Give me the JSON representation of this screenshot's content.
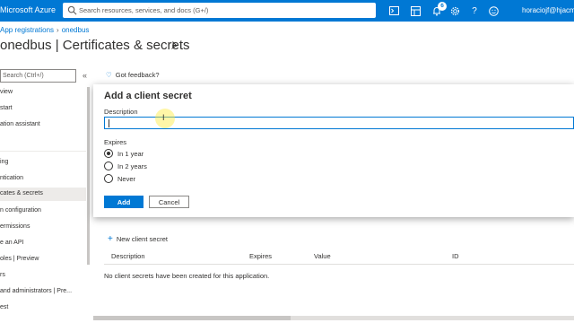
{
  "topbar": {
    "brand": "Microsoft Azure",
    "search_placeholder": "Search resources, services, and docs (G+/)",
    "notification_count": "6",
    "user": "horaciojf@hjacme.o",
    "icons": [
      "cloud-shell-icon",
      "directory-filter-icon",
      "bell-icon",
      "gear-icon",
      "help-icon",
      "feedback-smiley-icon"
    ],
    "accent_color": "#0078d4"
  },
  "breadcrumb": {
    "items": [
      "App registrations",
      "onedbus"
    ]
  },
  "page": {
    "title": "onedbus | Certificates & secrets"
  },
  "nav": {
    "search_placeholder": "Search (Ctrl+/)",
    "collapse_glyph": "«",
    "items": [
      "view",
      "start",
      "ation assistant",
      "",
      "ing",
      "ntication",
      "cates & secrets",
      "n configuration",
      "ermissions",
      "e an API",
      "oles | Preview",
      "rs",
      "and administrators | Pre...",
      "est"
    ]
  },
  "feedback": {
    "label": "Got feedback?"
  },
  "dialog": {
    "title": "Add a client secret",
    "description_label": "Description",
    "description_value": "",
    "expires_label": "Expires",
    "options": [
      "In 1 year",
      "In 2 years",
      "Never"
    ],
    "selected_option": "In 1 year",
    "add_label": "Add",
    "cancel_label": "Cancel"
  },
  "secrets": {
    "new_label": "New client secret",
    "columns": [
      "Description",
      "Expires",
      "Value",
      "ID"
    ],
    "empty_text": "No client secrets have been created for this application."
  }
}
